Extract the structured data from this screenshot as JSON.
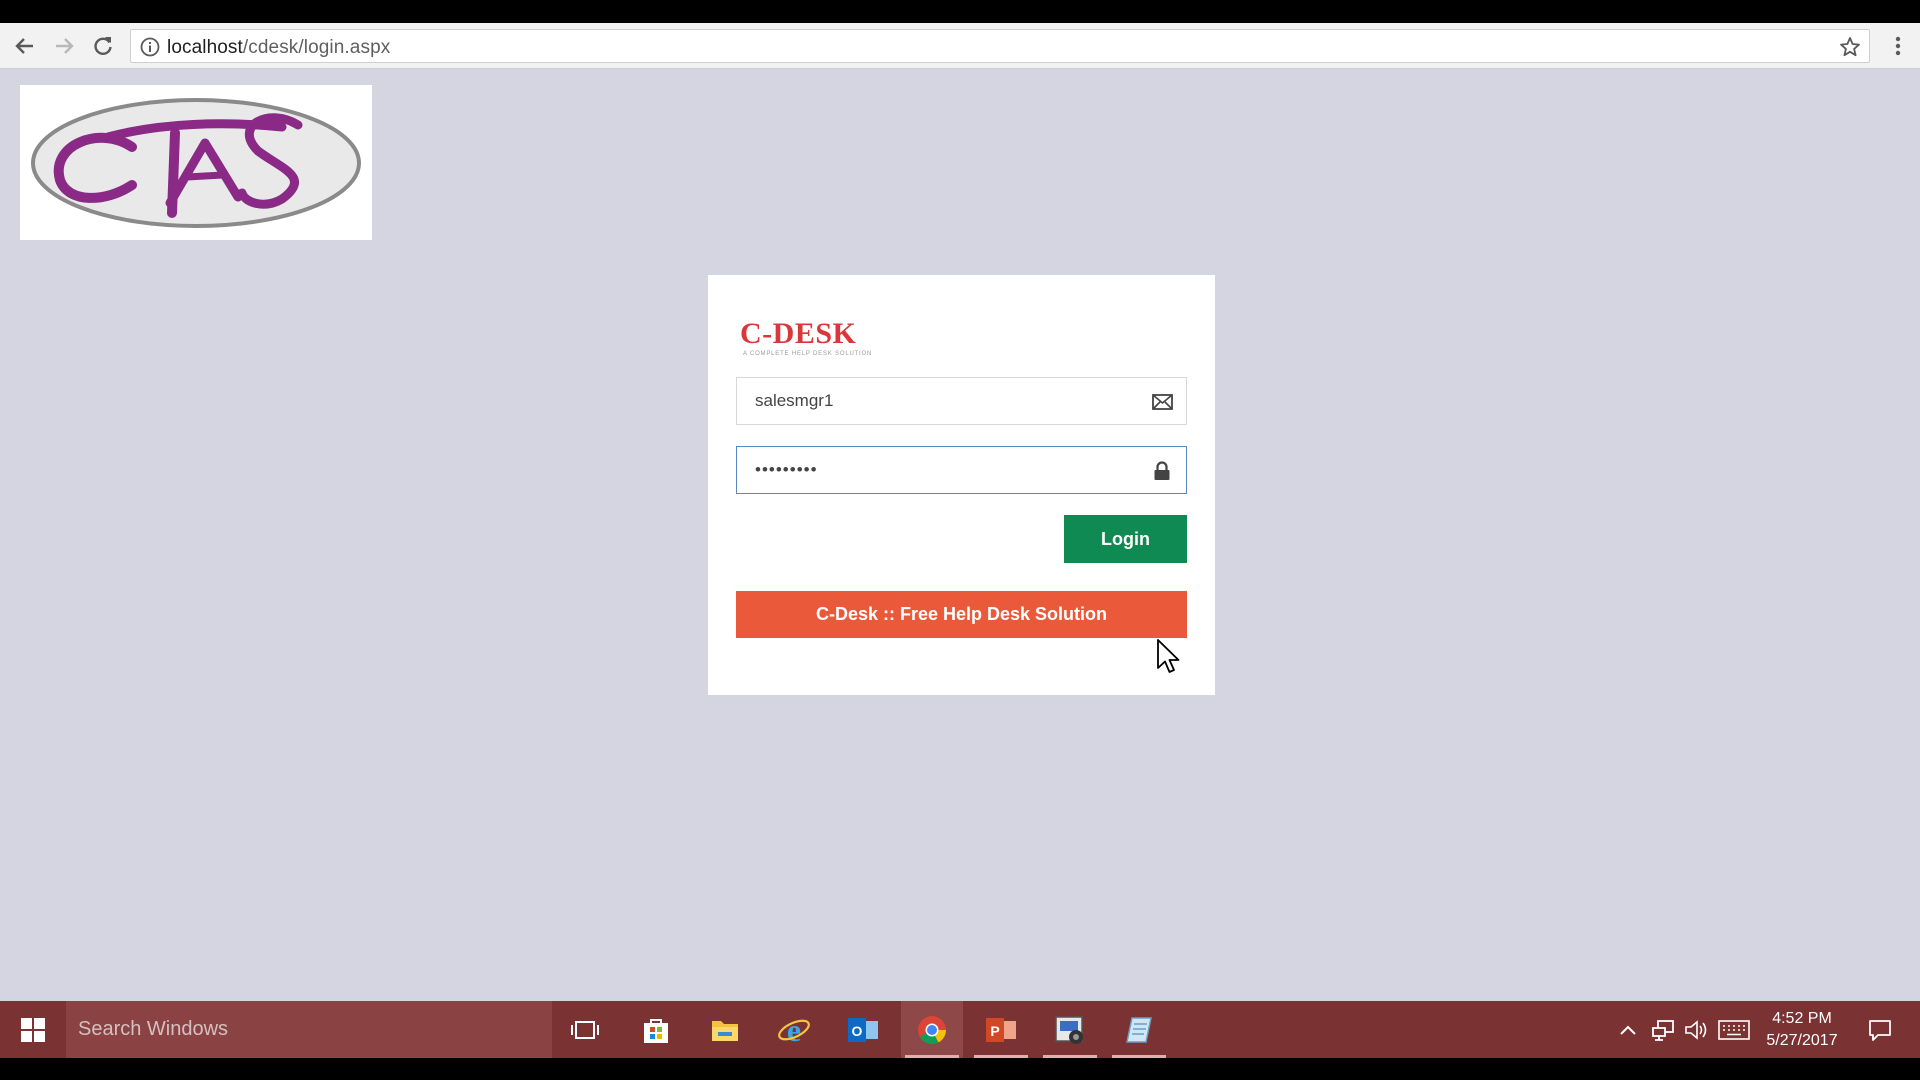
{
  "browser": {
    "url_host": "localhost",
    "url_path": "/cdesk/login.aspx",
    "icons": {
      "back": "arrow-left-icon",
      "forward": "arrow-right-icon",
      "reload": "reload-icon",
      "info": "info-icon",
      "bookmark": "star-icon",
      "menu": "vertical-dots-icon"
    }
  },
  "page": {
    "brand_logo_text": "CTAS",
    "login": {
      "logo_title": "C-DESK",
      "logo_tagline": "A COMPLETE HELP DESK SOLUTION",
      "username_value": "salesmgr1",
      "password_value": "•••••••••",
      "login_label": "Login",
      "promo_label": "C-Desk :: Free Help Desk Solution"
    },
    "colors": {
      "background": "#d4d5e0",
      "login_button": "#0f8a52",
      "promo_button": "#ea5a3a",
      "logo_red": "#d9373c",
      "brand_purple": "#8a2a86"
    }
  },
  "taskbar": {
    "search_placeholder": "Search Windows",
    "apps": [
      "task-view-icon",
      "store-icon",
      "file-explorer-icon",
      "internet-explorer-icon",
      "outlook-icon",
      "chrome-icon",
      "powerpoint-icon",
      "recorder-icon",
      "notes-icon"
    ],
    "time": "4:52 PM",
    "date": "5/27/2017",
    "color": "#7b3232"
  }
}
